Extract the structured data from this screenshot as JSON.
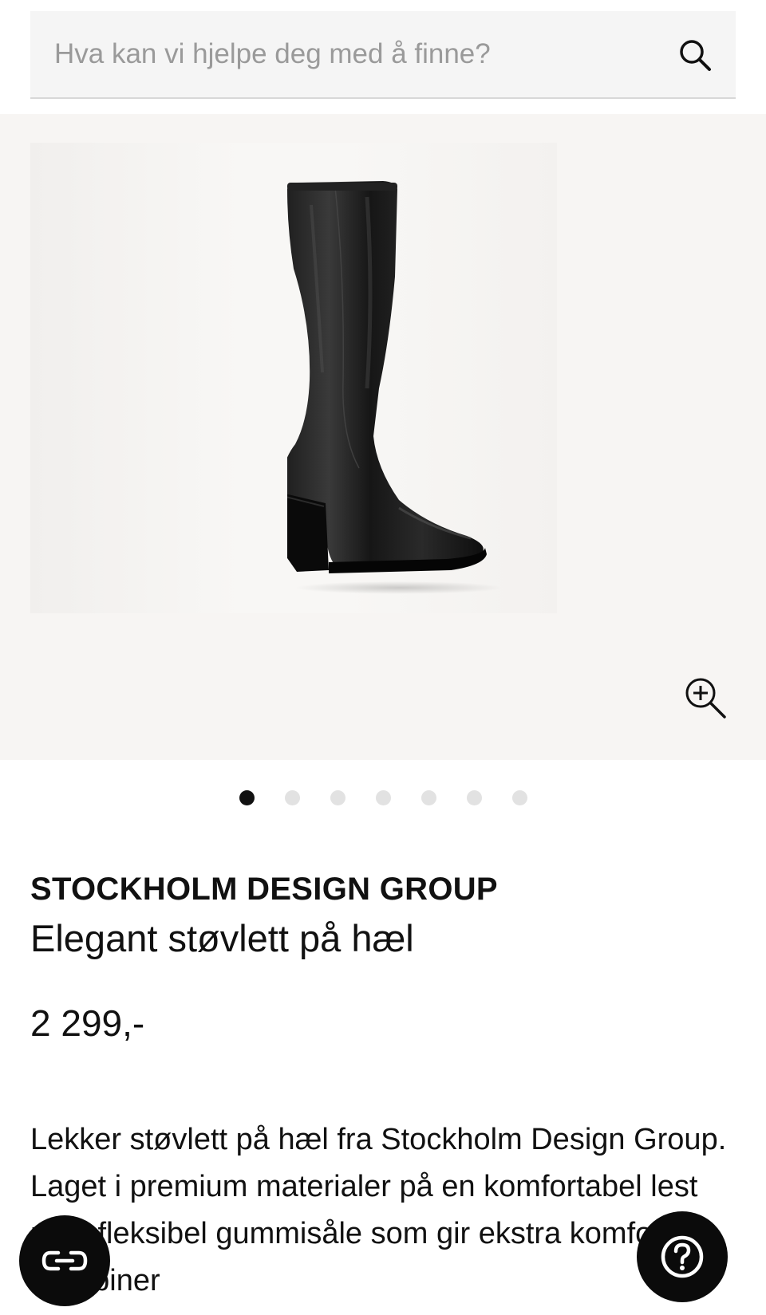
{
  "search": {
    "placeholder": "Hva kan vi hjelpe deg med å finne?"
  },
  "gallery": {
    "dot_count": 7,
    "active_index": 0
  },
  "product": {
    "brand": "STOCKHOLM DESIGN GROUP",
    "name": "Elegant støvlett på hæl",
    "price": "2 299,-",
    "description": "Lekker støvlett på hæl fra Stockholm Design Group. Laget i premium materialer på en komfortabel lest med fleksibel gummisåle som gir ekstra komfort. Kombiner"
  },
  "colors": {
    "background": "#ffffff",
    "search_background": "#f5f5f5",
    "gallery_background": "#f7f5f3",
    "dot_active": "#111111",
    "dot_inactive": "#e2e2e2",
    "fab": "#0b0b0b"
  },
  "icons": {
    "search": "search-icon",
    "zoom": "zoom-in-icon",
    "chat": "chat-link-icon",
    "help": "help-question-icon"
  }
}
